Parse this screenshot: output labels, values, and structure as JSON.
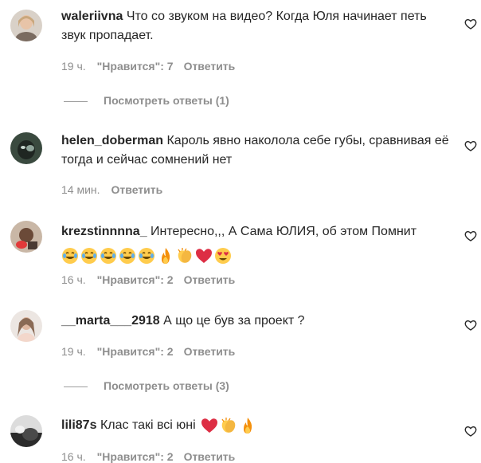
{
  "comments": [
    {
      "username": "waleriivna",
      "text": "Что со звуком на видео? Когда Юля начинает петь звук пропадает.",
      "time": "19 ч.",
      "likes": "\"Нравится\": 7",
      "reply": "Ответить",
      "view_replies": "Посмотреть ответы (1)"
    },
    {
      "username": "helen_doberman",
      "text": "Кароль явно наколола себе губы, сравнивая её тогда и сейчас сомнений нет",
      "time": "14 мин.",
      "reply": "Ответить"
    },
    {
      "username": "krezstinnnna_",
      "text": "Интересно,,, А Сама ЮЛИЯ, об этом Помнит",
      "emojis": [
        "joy-emoji",
        "joy-emoji",
        "joy-emoji",
        "joy-emoji",
        "joy-emoji",
        "fire-emoji",
        "clap-emoji",
        "heart-emoji",
        "heart-eyes-emoji"
      ],
      "time": "16 ч.",
      "likes": "\"Нравится\": 2",
      "reply": "Ответить"
    },
    {
      "username": "__marta___2918",
      "text": "А що це був за проект ?",
      "time": "19 ч.",
      "likes": "\"Нравится\": 2",
      "reply": "Ответить",
      "view_replies": "Посмотреть ответы (3)"
    },
    {
      "username": "lili87s",
      "text": "Клас такі всі юні",
      "emojis": [
        "heart-emoji",
        "clap-emoji",
        "fire-emoji"
      ],
      "time": "16 ч.",
      "likes": "\"Нравится\": 2",
      "reply": "Ответить"
    }
  ],
  "colors": {
    "text": "#262626",
    "secondary": "#8e8e8e",
    "heart_emoji": "#e0245e"
  }
}
